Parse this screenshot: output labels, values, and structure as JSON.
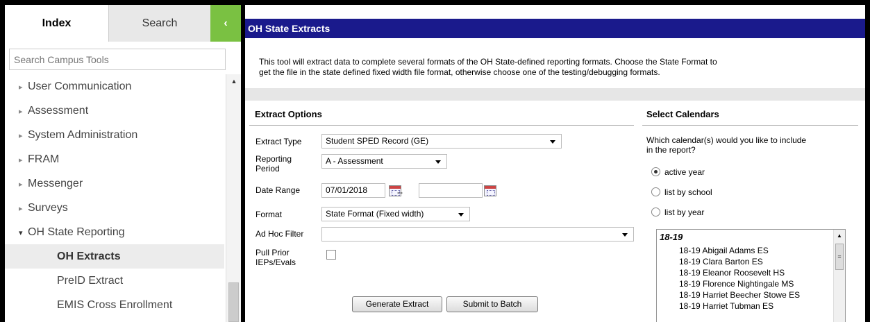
{
  "sidebar": {
    "tabs": {
      "index": "Index",
      "search": "Search",
      "collapse": "‹"
    },
    "search_placeholder": "Search Campus Tools",
    "items": [
      {
        "label": "User Communication",
        "arrow": "▸"
      },
      {
        "label": "Assessment",
        "arrow": "▸"
      },
      {
        "label": "System Administration",
        "arrow": "▸"
      },
      {
        "label": "FRAM",
        "arrow": "▸"
      },
      {
        "label": "Messenger",
        "arrow": "▸"
      },
      {
        "label": "Surveys",
        "arrow": "▸"
      },
      {
        "label": "OH State Reporting",
        "arrow": "▾"
      }
    ],
    "subitems": [
      {
        "label": "OH Extracts"
      },
      {
        "label": "PreID Extract"
      },
      {
        "label": "EMIS Cross Enrollment"
      }
    ]
  },
  "main": {
    "title": "OH State Extracts",
    "description_line1": "This tool will extract data to complete several formats of the OH State-defined reporting formats. Choose the State Format to",
    "description_line2": "get the file in the state defined fixed width file format, otherwise choose one of the testing/debugging formats.",
    "extract_options": {
      "title": "Extract Options",
      "extract_type_label": "Extract Type",
      "extract_type_value": "Student SPED Record (GE)",
      "reporting_period_label_1": "Reporting",
      "reporting_period_label_2": "Period",
      "reporting_period_value": "A - Assessment",
      "date_range_label": "Date Range",
      "date_start": "07/01/2018",
      "date_sep": "--",
      "date_end": "",
      "format_label": "Format",
      "format_value": "State Format (Fixed width)",
      "ad_hoc_label": "Ad Hoc Filter",
      "ad_hoc_value": "",
      "pull_prior_label_1": "Pull Prior",
      "pull_prior_label_2": "IEPs/Evals",
      "generate_button": "Generate Extract",
      "batch_button": "Submit to Batch"
    },
    "calendars": {
      "title": "Select Calendars",
      "question_1": "Which calendar(s) would you like to include",
      "question_2": "in the report?",
      "radio_active": "active year",
      "radio_school": "list by school",
      "radio_year": "list by year",
      "year": "18-19",
      "items": [
        "18-19 Abigail Adams ES",
        "18-19 Clara Barton ES",
        "18-19 Eleanor Roosevelt HS",
        "18-19 Florence Nightingale MS",
        "18-19 Harriet Beecher Stowe ES",
        "18-19 Harriet Tubman ES"
      ]
    }
  },
  "colors": {
    "header_bg": "#1a1a8c",
    "collapse_bg": "#7ac142"
  }
}
